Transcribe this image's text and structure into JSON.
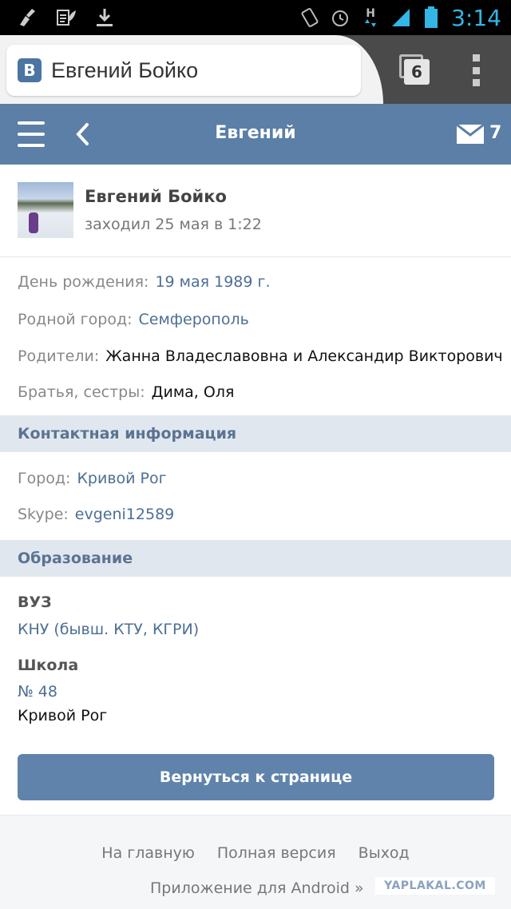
{
  "status_bar": {
    "time": "3:14",
    "icons": [
      "broom-icon",
      "clipboard-leaf-icon",
      "download-icon",
      "vibrate-icon",
      "alarm-icon",
      "network-h-icon",
      "signal-icon",
      "battery-icon"
    ],
    "network_label": "H",
    "time_color": "#33b5e5"
  },
  "browser": {
    "page_title": "Евгений Бойко",
    "site_logo_letter": "В",
    "tab_count": "6"
  },
  "header": {
    "title": "Евгений",
    "mail_count": "7",
    "background_color": "#5b7fa6"
  },
  "profile": {
    "name": "Евгений Бойко",
    "last_seen": "заходил 25 мая в 1:22"
  },
  "info": {
    "birthday_label": "День рождения:",
    "birthday_value": "19 мая 1989 г.",
    "hometown_label": "Родной город:",
    "hometown_value": "Семферополь",
    "parents_label": "Родители:",
    "parents_value": "Жанна Владеславовна и Александир Викторович",
    "siblings_label": "Братья, сестры:",
    "siblings_value": "Дима, Оля"
  },
  "contacts": {
    "section_title": "Контактная информация",
    "city_label": "Город:",
    "city_value": "Кривой Рог",
    "skype_label": "Skype:",
    "skype_value": "evgeni12589"
  },
  "education": {
    "section_title": "Образование",
    "university_label": "ВУЗ",
    "university_value": "КНУ (бывш. КТУ, КГРИ)",
    "school_label": "Школа",
    "school_value": "№ 48",
    "school_city": "Кривой Рог"
  },
  "actions": {
    "return_button": "Вернуться к странице"
  },
  "footer": {
    "home": "На главную",
    "full_version": "Полная версия",
    "logout": "Выход",
    "android_app": "Приложение для Android »"
  },
  "watermark": "YAPLAKAL.COM"
}
